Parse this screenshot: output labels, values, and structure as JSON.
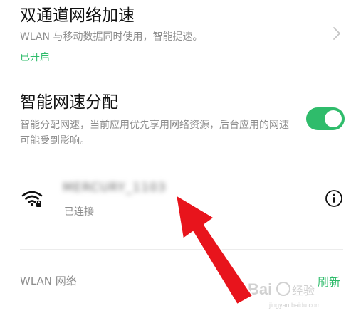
{
  "dual_channel": {
    "title": "双通道网络加速",
    "description": "WLAN 与移动数据同时使用，智能提速。",
    "status": "已开启"
  },
  "smart_allocation": {
    "title": "智能网速分配",
    "description": "智能分配网速，当前应用优先享用网络资源，后台应用的网速可能受到影响。",
    "toggle_state": "on"
  },
  "connected_network": {
    "ssid": "MERCURY_1103",
    "status": "已连接",
    "icon": "wifi-locked-icon"
  },
  "wlan_section": {
    "header": "WLAN 网络",
    "refresh_label": "刷新"
  },
  "colors": {
    "accent": "#2fbc6b",
    "annotation": "#e8141c"
  }
}
